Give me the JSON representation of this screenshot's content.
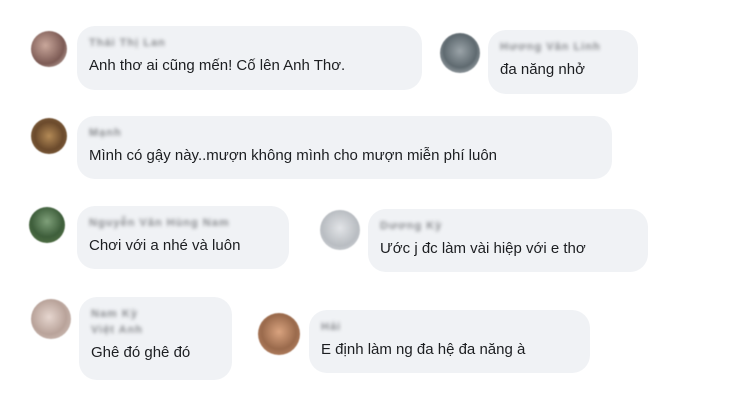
{
  "comments": [
    {
      "name": "Thái Thị Lan",
      "text": "Anh thơ ai cũng mến! Cố lên Anh Thơ."
    },
    {
      "name": "Hương Văn Linh",
      "text": "đa năng nhở"
    },
    {
      "name": "Mạnh",
      "text": "Mình có gậy này..mượn không mình cho mượn miễn phí luôn"
    },
    {
      "name": "Nguyễn Văn Hùng Nam",
      "text": "Chơi với a nhé và luôn"
    },
    {
      "name": "Dương Kỳ",
      "text": "Ước j đc làm vài hiệp với e thơ"
    },
    {
      "name": "Nam Kỳ",
      "name2": "Việt Anh",
      "text": "Ghê đó ghê đó"
    },
    {
      "name": "Hải",
      "text": "E định làm ng đa hệ đa năng à"
    }
  ],
  "colors": {
    "bubble": "#f0f2f5",
    "text": "#1c1e21",
    "name": "#65676b"
  }
}
